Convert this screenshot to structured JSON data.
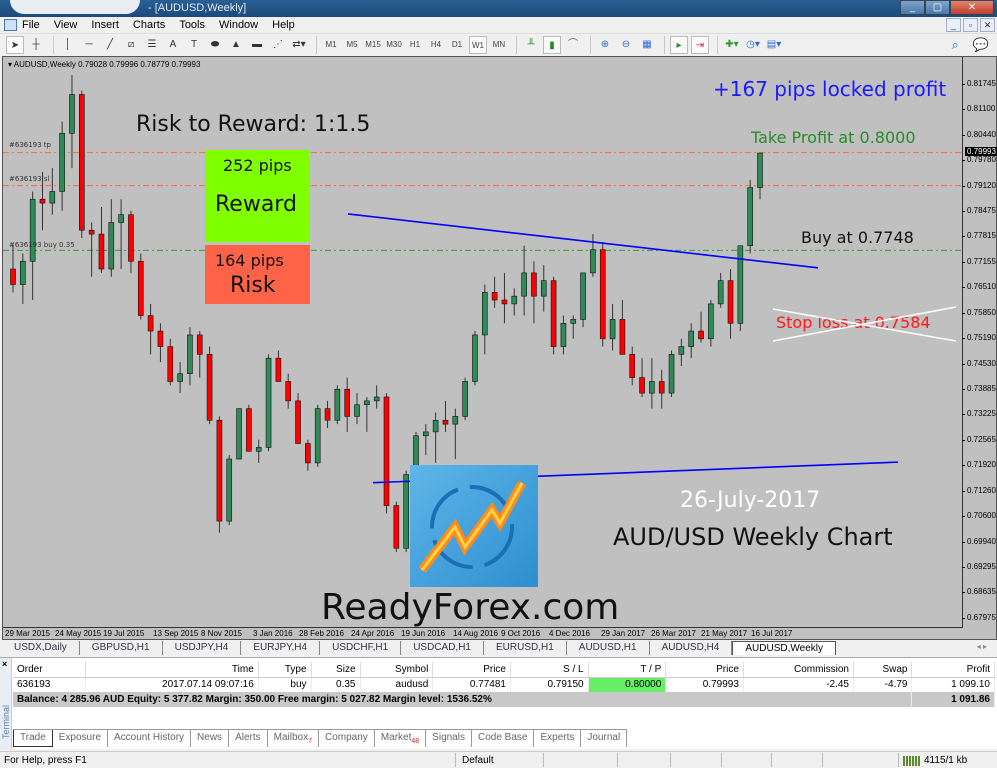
{
  "window": {
    "title": "- [AUDUSD,Weekly]",
    "minimize": "_",
    "maximize": "▢",
    "close": "✕"
  },
  "menu": [
    "File",
    "View",
    "Insert",
    "Charts",
    "Tools",
    "Window",
    "Help"
  ],
  "mdi_buttons": [
    "_",
    "▫",
    "✕"
  ],
  "toolbar": {
    "drawing_tools": [
      "cursor-icon",
      "crosshair-icon",
      "vertical-line-icon",
      "horizontal-line-icon",
      "trendline-icon",
      "equidistant-channel-icon",
      "fibonacci-icon",
      "text-icon",
      "text-label-icon",
      "ellipse-icon",
      "triangle-icon",
      "rectangle-icon",
      "fibo-fan-icon",
      "arrows-icon"
    ],
    "timeframes": [
      "M1",
      "M5",
      "M15",
      "M30",
      "H1",
      "H4",
      "D1",
      "W1",
      "MN"
    ],
    "selected_timeframe": "W1"
  },
  "chart": {
    "header": "AUDUSD,Weekly  0.79028 0.79996 0.78779 0.79993",
    "order_labels": [
      "#636193 tp",
      "#636193 sl",
      "#636193 buy 0.35"
    ],
    "annotations": {
      "risk_reward": "Risk to Reward: 1:1.5",
      "reward_pips": "252 pips",
      "reward_label": "Reward",
      "risk_pips": "164 pips",
      "risk_label": "Risk",
      "locked_profit": "+167 pips locked profit",
      "take_profit": "Take Profit at 0.8000",
      "buy_at": "Buy at 0.7748",
      "stop_loss": "Stop loss at 0.7584",
      "date": "26-July-2017",
      "chart_title": "AUD/USD Weekly Chart",
      "brand": "ReadyForex.com"
    },
    "colors": {
      "bull": "#2e8b57",
      "bear": "#ff0000",
      "trendline": "#0000ff",
      "tp_line": "#ff6a33",
      "entry_line": "#2e9e2e",
      "reward_box": "#80ff00",
      "risk_box": "#ff6347"
    }
  },
  "chart_data": {
    "type": "candlestick",
    "title": "AUDUSD,Weekly",
    "ohlc_last": {
      "open": 0.79028,
      "high": 0.79996,
      "low": 0.78779,
      "close": 0.79993
    },
    "y_ticks": [
      "0.81745",
      "0.81100",
      "0.80440",
      "0.79780",
      "0.79120",
      "0.78475",
      "0.77815",
      "0.77155",
      "0.76510",
      "0.75850",
      "0.75190",
      "0.74530",
      "0.73885",
      "0.73225",
      "0.72565",
      "0.71920",
      "0.71260",
      "0.70600",
      "0.69940",
      "0.69295",
      "0.68635",
      "0.67975"
    ],
    "ylim": [
      0.67975,
      0.81745
    ],
    "current_price": "0.79993",
    "x_ticks": [
      "29 Mar 2015",
      "24 May 2015",
      "19 Jul 2015",
      "13 Sep 2015",
      "8 Nov 2015",
      "3 Jan 2016",
      "28 Feb 2016",
      "24 Apr 2016",
      "19 Jun 2016",
      "14 Aug 2016",
      "9 Oct 2016",
      "4 Dec 2016",
      "29 Jan 2017",
      "26 Mar 2017",
      "21 May 2017",
      "16 Jul 2017"
    ],
    "levels": {
      "take_profit": 0.8,
      "stop_loss_moved": 0.7915,
      "entry": 0.7748
    },
    "candles": [
      [
        0.77,
        0.776,
        0.764,
        0.766
      ],
      [
        0.766,
        0.774,
        0.761,
        0.772
      ],
      [
        0.772,
        0.79,
        0.762,
        0.788
      ],
      [
        0.788,
        0.795,
        0.78,
        0.787
      ],
      [
        0.787,
        0.796,
        0.784,
        0.79
      ],
      [
        0.79,
        0.808,
        0.785,
        0.805
      ],
      [
        0.805,
        0.82,
        0.796,
        0.815
      ],
      [
        0.815,
        0.816,
        0.778,
        0.78
      ],
      [
        0.78,
        0.782,
        0.768,
        0.779
      ],
      [
        0.779,
        0.786,
        0.769,
        0.77
      ],
      [
        0.77,
        0.788,
        0.768,
        0.782
      ],
      [
        0.782,
        0.788,
        0.77,
        0.784
      ],
      [
        0.784,
        0.785,
        0.769,
        0.772
      ],
      [
        0.772,
        0.774,
        0.757,
        0.758
      ],
      [
        0.758,
        0.761,
        0.748,
        0.754
      ],
      [
        0.754,
        0.756,
        0.746,
        0.75
      ],
      [
        0.75,
        0.752,
        0.74,
        0.741
      ],
      [
        0.741,
        0.746,
        0.738,
        0.743
      ],
      [
        0.743,
        0.755,
        0.74,
        0.753
      ],
      [
        0.753,
        0.754,
        0.742,
        0.748
      ],
      [
        0.748,
        0.75,
        0.73,
        0.731
      ],
      [
        0.731,
        0.732,
        0.702,
        0.705
      ],
      [
        0.705,
        0.722,
        0.704,
        0.721
      ],
      [
        0.721,
        0.733,
        0.722,
        0.734
      ],
      [
        0.734,
        0.735,
        0.725,
        0.723
      ],
      [
        0.723,
        0.726,
        0.72,
        0.724
      ],
      [
        0.724,
        0.748,
        0.723,
        0.747
      ],
      [
        0.747,
        0.749,
        0.741,
        0.741
      ],
      [
        0.741,
        0.743,
        0.734,
        0.736
      ],
      [
        0.736,
        0.738,
        0.732,
        0.725
      ],
      [
        0.725,
        0.726,
        0.718,
        0.72
      ],
      [
        0.72,
        0.735,
        0.719,
        0.734
      ],
      [
        0.734,
        0.736,
        0.729,
        0.731
      ],
      [
        0.731,
        0.74,
        0.73,
        0.739
      ],
      [
        0.739,
        0.742,
        0.728,
        0.732
      ],
      [
        0.732,
        0.738,
        0.73,
        0.735
      ],
      [
        0.735,
        0.737,
        0.728,
        0.736
      ],
      [
        0.736,
        0.74,
        0.734,
        0.737
      ],
      [
        0.737,
        0.738,
        0.707,
        0.709
      ],
      [
        0.709,
        0.71,
        0.697,
        0.698
      ],
      [
        0.698,
        0.718,
        0.697,
        0.717
      ],
      [
        0.717,
        0.728,
        0.715,
        0.727
      ],
      [
        0.727,
        0.73,
        0.722,
        0.728
      ],
      [
        0.728,
        0.733,
        0.72,
        0.731
      ],
      [
        0.731,
        0.736,
        0.728,
        0.73
      ],
      [
        0.73,
        0.734,
        0.721,
        0.732
      ],
      [
        0.732,
        0.742,
        0.731,
        0.741
      ],
      [
        0.741,
        0.754,
        0.74,
        0.753
      ],
      [
        0.753,
        0.766,
        0.748,
        0.764
      ],
      [
        0.764,
        0.768,
        0.76,
        0.762
      ],
      [
        0.762,
        0.769,
        0.756,
        0.761
      ],
      [
        0.761,
        0.765,
        0.758,
        0.763
      ],
      [
        0.763,
        0.776,
        0.758,
        0.769
      ],
      [
        0.769,
        0.772,
        0.756,
        0.763
      ],
      [
        0.763,
        0.771,
        0.759,
        0.767
      ],
      [
        0.767,
        0.768,
        0.748,
        0.75
      ],
      [
        0.75,
        0.758,
        0.748,
        0.756
      ],
      [
        0.756,
        0.758,
        0.752,
        0.757
      ],
      [
        0.757,
        0.768,
        0.755,
        0.769
      ],
      [
        0.769,
        0.779,
        0.768,
        0.775
      ],
      [
        0.775,
        0.777,
        0.75,
        0.752
      ],
      [
        0.752,
        0.761,
        0.749,
        0.757
      ],
      [
        0.757,
        0.762,
        0.749,
        0.748
      ],
      [
        0.748,
        0.75,
        0.74,
        0.742
      ],
      [
        0.742,
        0.747,
        0.737,
        0.738
      ],
      [
        0.738,
        0.747,
        0.734,
        0.741
      ],
      [
        0.741,
        0.744,
        0.734,
        0.738
      ],
      [
        0.738,
        0.749,
        0.737,
        0.748
      ],
      [
        0.748,
        0.752,
        0.745,
        0.75
      ],
      [
        0.75,
        0.756,
        0.747,
        0.754
      ],
      [
        0.754,
        0.759,
        0.751,
        0.752
      ],
      [
        0.752,
        0.762,
        0.75,
        0.761
      ],
      [
        0.761,
        0.769,
        0.76,
        0.767
      ],
      [
        0.767,
        0.77,
        0.752,
        0.756
      ],
      [
        0.756,
        0.776,
        0.754,
        0.776
      ],
      [
        0.776,
        0.793,
        0.774,
        0.791
      ],
      [
        0.791,
        0.8,
        0.788,
        0.7999
      ]
    ],
    "trendlines": [
      {
        "name": "upper-trendline",
        "from": [
          0.7842,
          "Mar 2016"
        ],
        "to": [
          0.7703,
          "Aug 2017"
        ]
      },
      {
        "name": "lower-trendline",
        "from": [
          0.7149,
          "May 2016"
        ],
        "to": [
          0.7202,
          "Sep 2017"
        ]
      }
    ]
  },
  "symbol_tabs": [
    "USDX,Daily",
    "GBPUSD,H1",
    "USDJPY,H4",
    "EURJPY,H4",
    "USDCHF,H1",
    "USDCAD,H1",
    "EURUSD,H1",
    "AUDUSD,H1",
    "AUDUSD,H4",
    "AUDUSD,Weekly"
  ],
  "active_symbol_tab": "AUDUSD,Weekly",
  "terminal": {
    "side_label": "Terminal",
    "close": "×",
    "columns": [
      "Order",
      "Time",
      "Type",
      "Size",
      "Symbol",
      "Price",
      "S / L",
      "T / P",
      "Price",
      "Commission",
      "Swap",
      "Profit"
    ],
    "sort_indicator": "/",
    "orders": [
      {
        "order": "636193",
        "time": "2017.07.14 09:07:16",
        "type": "buy",
        "size": "0.35",
        "symbol": "audusd",
        "price": "0.77481",
        "sl": "0.79150",
        "tp": "0.80000",
        "cur_price": "0.79993",
        "commission": "-2.45",
        "swap": "-4.79",
        "profit": "1 099.10"
      }
    ],
    "balance_line": "Balance: 4 285.96 AUD  Equity: 5 377.82  Margin: 350.00  Free margin: 5 027.82  Margin level: 1536.52%",
    "total_profit": "1 091.86",
    "tabs": [
      {
        "label": "Trade",
        "active": true
      },
      {
        "label": "Exposure"
      },
      {
        "label": "Account History"
      },
      {
        "label": "News"
      },
      {
        "label": "Alerts"
      },
      {
        "label": "Mailbox",
        "badge": "7"
      },
      {
        "label": "Company"
      },
      {
        "label": "Market",
        "badge": "48"
      },
      {
        "label": "Signals"
      },
      {
        "label": "Code Base"
      },
      {
        "label": "Experts"
      },
      {
        "label": "Journal"
      }
    ]
  },
  "statusbar": {
    "help": "For Help, press F1",
    "profile": "Default",
    "traffic": "4115/1 kb"
  }
}
